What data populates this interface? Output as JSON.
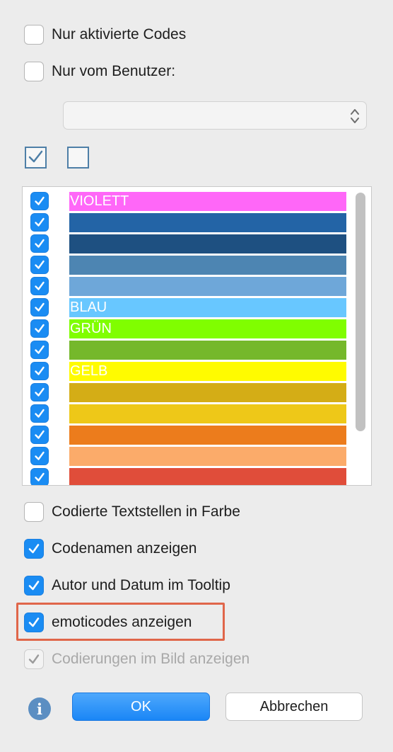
{
  "options_top": [
    {
      "label": "Nur aktivierte Codes",
      "checked": false
    },
    {
      "label": "Nur vom Benutzer:",
      "checked": false
    }
  ],
  "user_select": {
    "value": ""
  },
  "select_all_icon": "checked-square-icon",
  "deselect_all_icon": "empty-square-icon",
  "codes": [
    {
      "label": "VIOLETT",
      "color": "#ff67f8",
      "checked": true
    },
    {
      "label": "",
      "color": "#2364a6",
      "checked": true
    },
    {
      "label": "",
      "color": "#1e5081",
      "checked": true
    },
    {
      "label": "",
      "color": "#4d85b2",
      "checked": true
    },
    {
      "label": "",
      "color": "#6ea7d9",
      "checked": true
    },
    {
      "label": "BLAU",
      "color": "#68c7ff",
      "checked": true
    },
    {
      "label": "GRÜN",
      "color": "#80fe00",
      "checked": true
    },
    {
      "label": "",
      "color": "#75b82b",
      "checked": true
    },
    {
      "label": "GELB",
      "color": "#fffb00",
      "checked": true
    },
    {
      "label": "",
      "color": "#d4ad16",
      "checked": true
    },
    {
      "label": "",
      "color": "#eec818",
      "checked": true
    },
    {
      "label": "",
      "color": "#ec7c1c",
      "checked": true
    },
    {
      "label": "",
      "color": "#fbab6a",
      "checked": true
    },
    {
      "label": "",
      "color": "#e04d3a",
      "checked": true
    }
  ],
  "options_bottom": [
    {
      "label": "Codierte Textstellen in Farbe",
      "checked": false,
      "disabled": false
    },
    {
      "label": "Codenamen anzeigen",
      "checked": true,
      "disabled": false
    },
    {
      "label": "Autor und Datum im Tooltip",
      "checked": true,
      "disabled": false
    },
    {
      "label": "emoticodes anzeigen",
      "checked": true,
      "disabled": false
    },
    {
      "label": "Codierungen im Bild anzeigen",
      "checked": true,
      "disabled": true
    }
  ],
  "highlight_color": "#e0664a",
  "buttons": {
    "info": "i",
    "ok": "OK",
    "cancel": "Abbrechen"
  }
}
